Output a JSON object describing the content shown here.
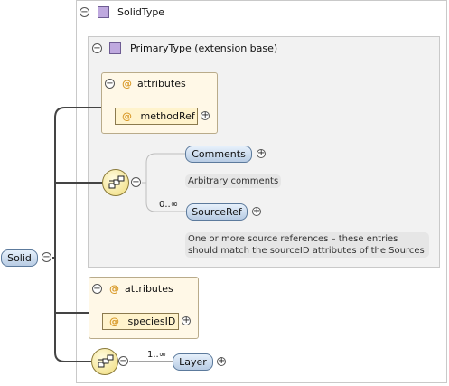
{
  "solid_type": {
    "label": "SolidType"
  },
  "primary_type": {
    "label": "PrimaryType (extension base)"
  },
  "attrs_primary": {
    "label": "attributes",
    "attribute": "methodRef"
  },
  "comments": {
    "label": "Comments",
    "note": "Arbitrary comments"
  },
  "source_ref": {
    "label": "SourceRef",
    "multiplicity": "0..∞",
    "note_line1": "One or more source references – these entries",
    "note_line2": "should match the sourceID attributes of the Sources"
  },
  "attrs_solid": {
    "label": "attributes",
    "attribute": "speciesID"
  },
  "root": {
    "label": "Solid"
  },
  "layer": {
    "label": "Layer",
    "multiplicity": "1..∞"
  },
  "colors": {
    "element_fill": "#b8cce4",
    "attribute_fill": "#fff3cc",
    "type_icon": "#bfa9df",
    "sequence_fill": "#f0dc7a"
  },
  "icons": {
    "collapse": "collapse-icon",
    "expand": "expand-icon",
    "type": "complex-type-icon",
    "attribute": "attribute-at-icon",
    "sequence": "sequence-compositor-icon"
  },
  "symbols": {
    "collapse": "−",
    "expand": "+",
    "at": "@"
  }
}
